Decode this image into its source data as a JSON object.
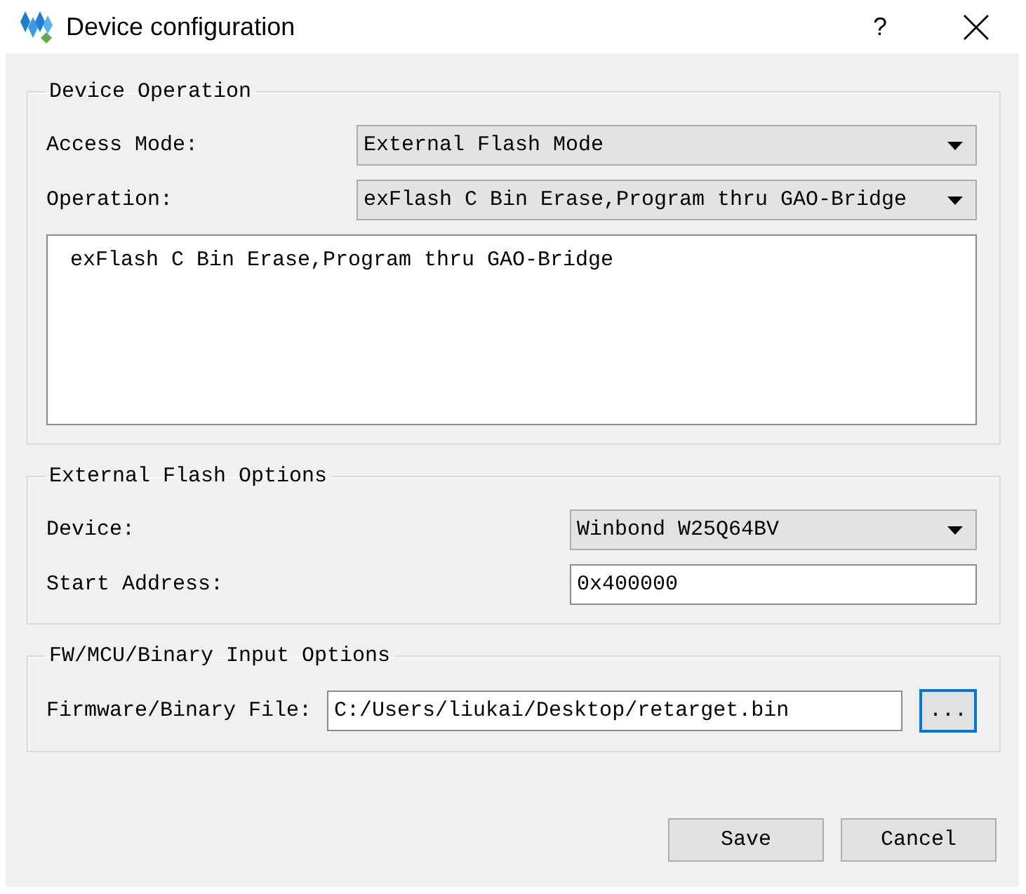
{
  "window": {
    "title": "Device configuration",
    "help_button": "?"
  },
  "groups": [
    {
      "title": "Device Operation",
      "fields": [
        {
          "kind": "dropdown",
          "label": "Access Mode:",
          "value": "External Flash Mode"
        },
        {
          "kind": "dropdown",
          "label": "Operation:",
          "value": "exFlash C Bin Erase,Program thru GAO-Bridge"
        }
      ],
      "description": "exFlash C Bin Erase,Program thru GAO-Bridge"
    },
    {
      "title": "External Flash Options",
      "fields": [
        {
          "kind": "dropdown",
          "label": "Device:",
          "value": "Winbond W25Q64BV"
        },
        {
          "kind": "text",
          "label": "Start Address:",
          "value": "0x400000"
        }
      ]
    },
    {
      "title": "FW/MCU/Binary Input Options",
      "fields": [
        {
          "kind": "file",
          "label": "Firmware/Binary File:",
          "value": "C:/Users/liukai/Desktop/retarget.bin",
          "browse_button": {
            "label": "...",
            "focused": true
          }
        }
      ]
    }
  ],
  "buttons": [
    "Save",
    "Cancel"
  ]
}
